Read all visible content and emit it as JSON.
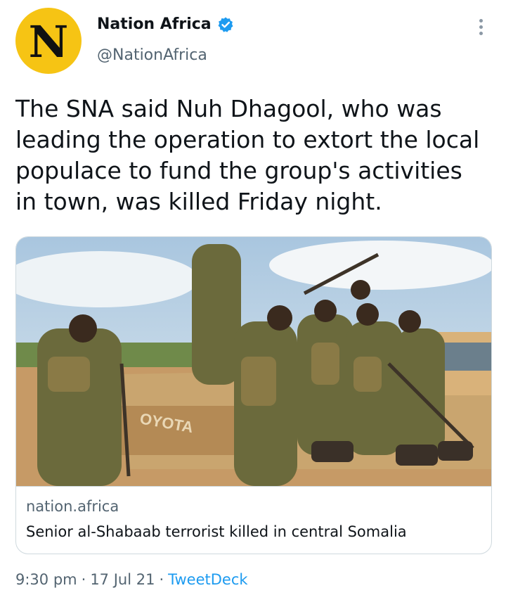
{
  "author": {
    "avatar_letter": "N",
    "display_name": "Nation Africa",
    "handle": "@NationAfrica",
    "verified": true
  },
  "tweet": {
    "text": "The SNA said Nuh Dhagool, who was leading the operation to extort the local populace to fund the group's activities in town, was killed Friday night."
  },
  "card": {
    "domain": "nation.africa",
    "title": "Senior al-Shabaab terrorist killed in central Somalia",
    "image_text": "OYOTA"
  },
  "meta": {
    "time": "9:30 pm",
    "separator": "·",
    "date": "17 Jul 21",
    "source": "TweetDeck"
  },
  "colors": {
    "accent": "#1d9bf0",
    "avatar_bg": "#f6c414",
    "secondary_text": "#536471",
    "border": "#cfd9de"
  },
  "icons": [
    "verified-badge-icon",
    "more-options-icon"
  ]
}
